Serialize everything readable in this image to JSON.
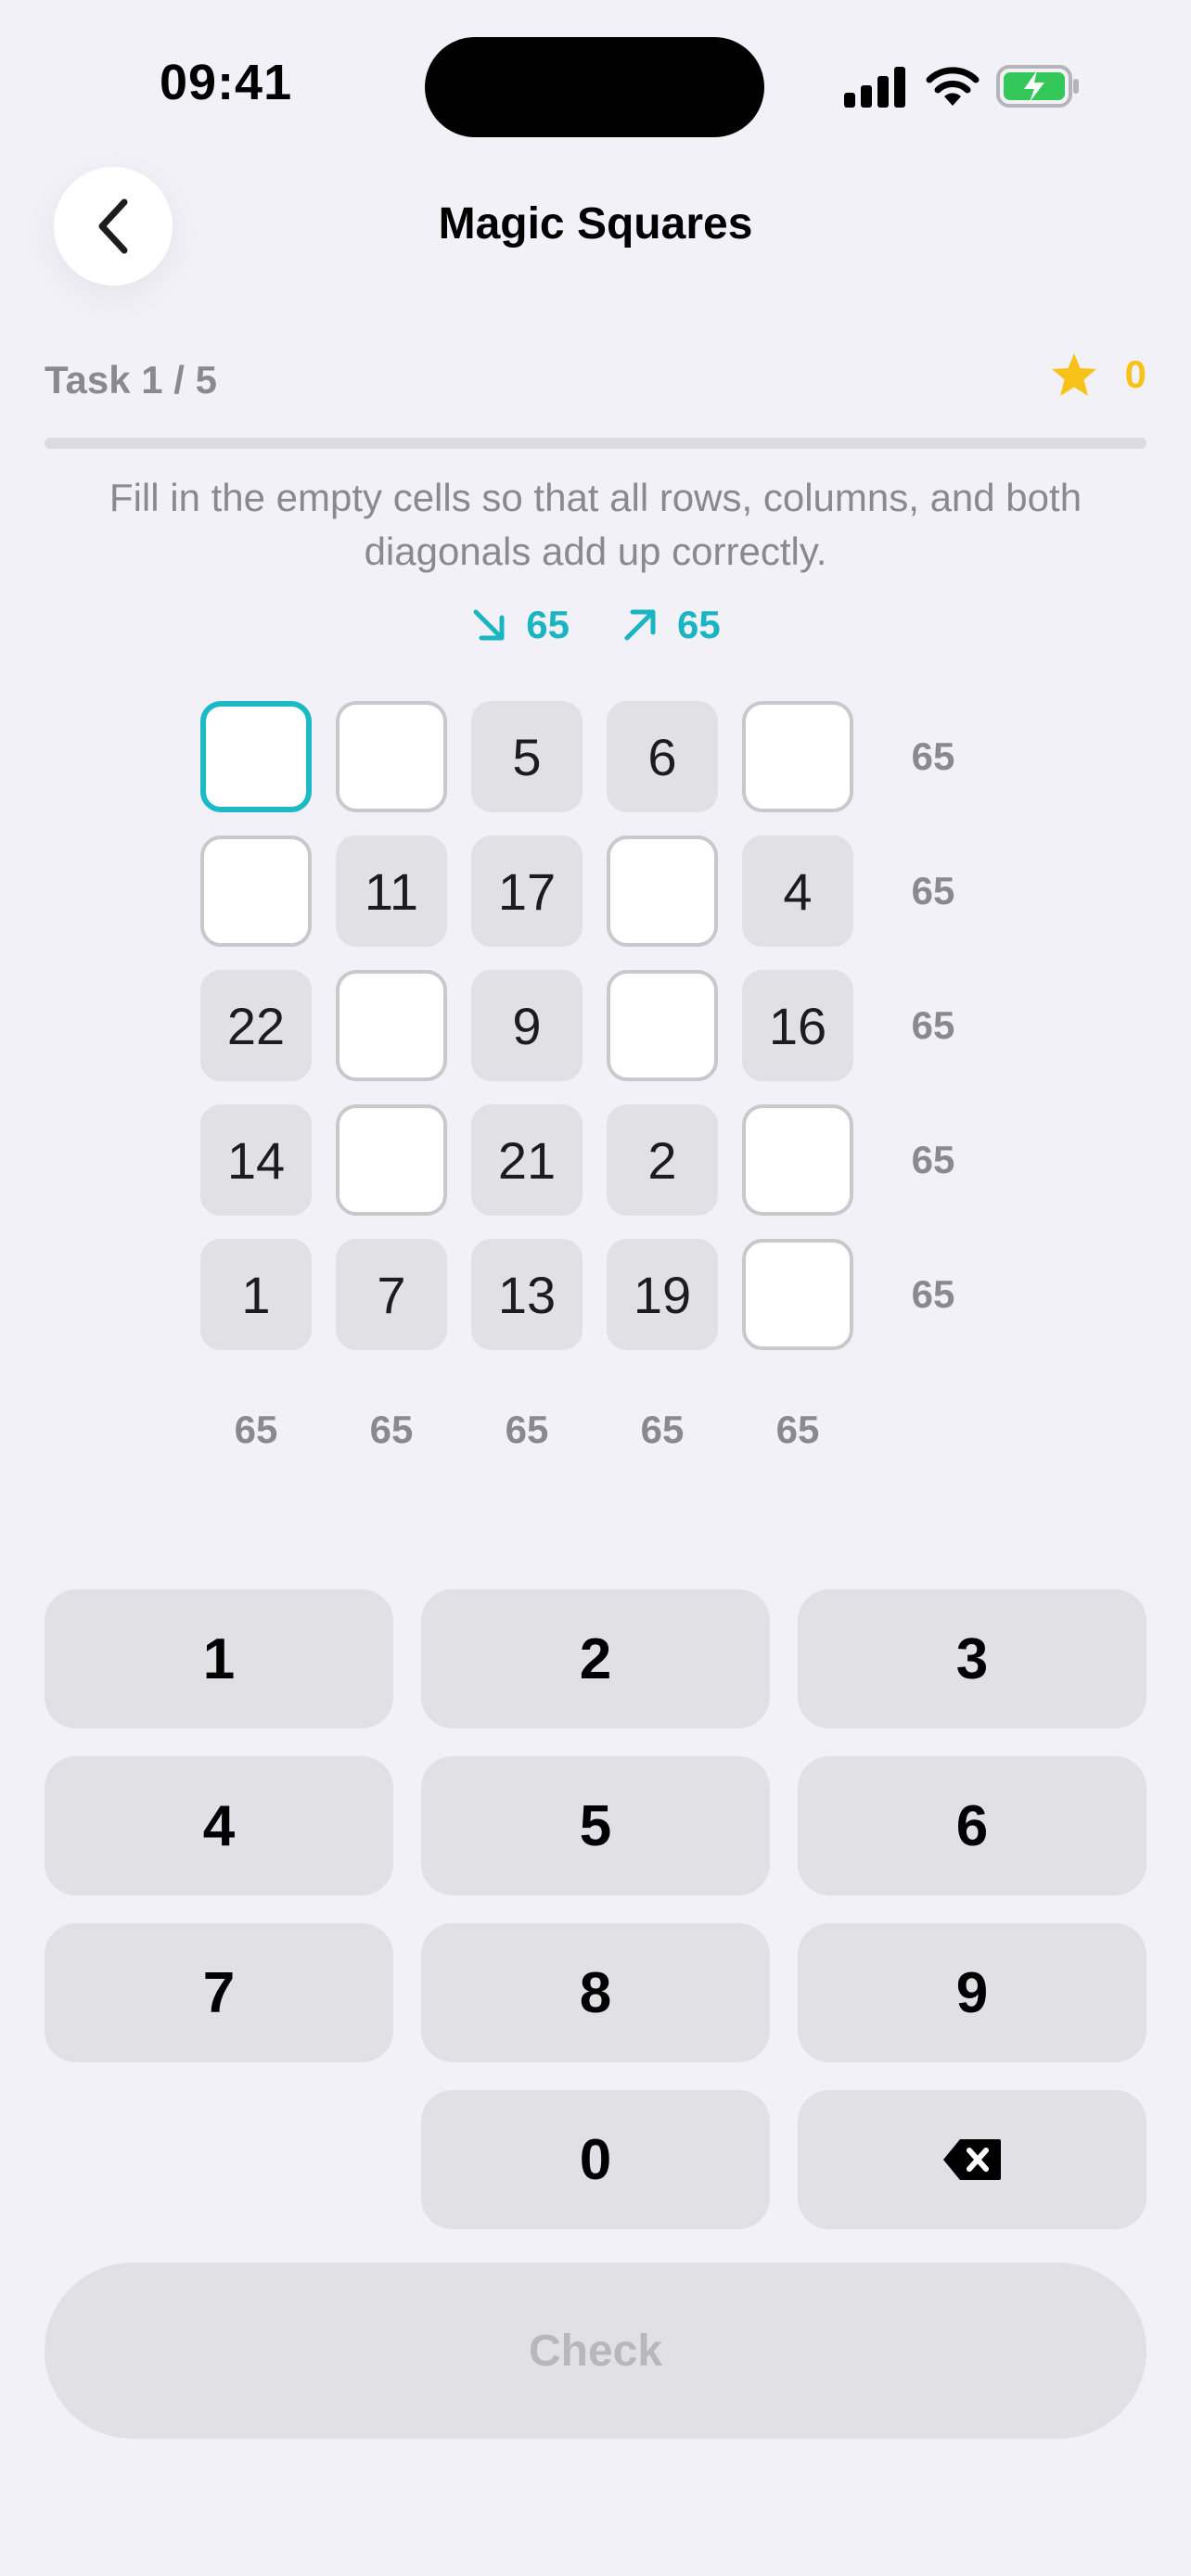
{
  "status_bar": {
    "time": "09:41"
  },
  "nav": {
    "title": "Magic Squares"
  },
  "task": {
    "label": "Task 1 / 5",
    "stars": "0",
    "progress": 0
  },
  "instructions": "Fill in the empty cells so that all rows, columns, and both diagonals add up correctly.",
  "diagonals": {
    "down_sum": "65",
    "up_sum": "65"
  },
  "grid": {
    "rows": [
      [
        "",
        "",
        "5",
        "6",
        ""
      ],
      [
        "",
        "11",
        "17",
        "",
        "4"
      ],
      [
        "22",
        "",
        "9",
        "",
        "16"
      ],
      [
        "14",
        "",
        "21",
        "2",
        ""
      ],
      [
        "1",
        "7",
        "13",
        "19",
        ""
      ]
    ],
    "selected": [
      0,
      0
    ],
    "row_sums": [
      "65",
      "65",
      "65",
      "65",
      "65"
    ],
    "col_sums": [
      "65",
      "65",
      "65",
      "65",
      "65"
    ]
  },
  "keypad": {
    "keys": [
      "1",
      "2",
      "3",
      "4",
      "5",
      "6",
      "7",
      "8",
      "9",
      "0"
    ],
    "delete_icon": "backspace-icon"
  },
  "check_label": "Check",
  "colors": {
    "accent": "#1cbac6",
    "star": "#f7c21a",
    "battery": "#34c759"
  }
}
